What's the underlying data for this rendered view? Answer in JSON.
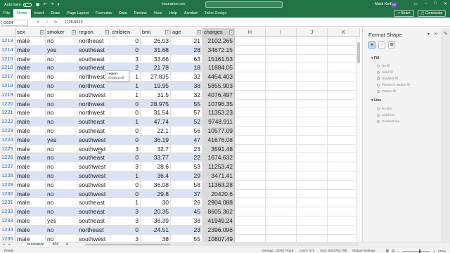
{
  "titlebar": {
    "autosave_label": "AutoSave",
    "autosave_state": "Off",
    "filename": "insurance.csv",
    "user_name": "Mark Keith",
    "user_initials": "MK"
  },
  "ribbon": {
    "tabs": [
      "File",
      "Home",
      "Insert",
      "Draw",
      "Page Layout",
      "Formulas",
      "Data",
      "Review",
      "View",
      "Help",
      "Acrobat",
      "Table Design"
    ],
    "active_tab": "Home",
    "share_label": "Share",
    "comments_label": "Comments"
  },
  "formula_bar": {
    "name_box": "G664",
    "formula": "1725.5523"
  },
  "columns": {
    "headers": [
      "sex",
      "smoker",
      "region",
      "children",
      "bmi",
      "age",
      "charges"
    ],
    "letters": [
      "H",
      "I",
      "J",
      "K"
    ]
  },
  "rows": [
    {
      "num": "1213",
      "sex": "male",
      "smoker": "no",
      "region": "northeast",
      "children": "0",
      "bmi": "26.03",
      "age": "21",
      "charges": "2102.265"
    },
    {
      "num": "1214",
      "sex": "male",
      "smoker": "yes",
      "region": "southeast",
      "children": "0",
      "bmi": "31.68",
      "age": "28",
      "charges": "34672.15"
    },
    {
      "num": "1215",
      "sex": "male",
      "smoker": "no",
      "region": "southeast",
      "children": "3",
      "bmi": "33.66",
      "age": "63",
      "charges": "15161.53"
    },
    {
      "num": "1216",
      "sex": "male",
      "smoker": "no",
      "region": "southeast",
      "children": "2",
      "bmi": "21.78",
      "age": "18",
      "charges": "11884.05"
    },
    {
      "num": "1217",
      "sex": "male",
      "smoker": "no",
      "region": "northwest",
      "children": "1",
      "bmi": "27.835",
      "age": "32",
      "charges": "4454.403"
    },
    {
      "num": "1218",
      "sex": "male",
      "smoker": "no",
      "region": "northwest",
      "children": "1",
      "bmi": "19.95",
      "age": "38",
      "charges": "5855.903"
    },
    {
      "num": "1219",
      "sex": "male",
      "smoker": "no",
      "region": "southwest",
      "children": "1",
      "bmi": "31.5",
      "age": "32",
      "charges": "4076.497"
    },
    {
      "num": "1220",
      "sex": "male",
      "smoker": "no",
      "region": "northwest",
      "children": "0",
      "bmi": "28.975",
      "age": "55",
      "charges": "10796.35"
    },
    {
      "num": "1221",
      "sex": "male",
      "smoker": "no",
      "region": "northwest",
      "children": "0",
      "bmi": "31.54",
      "age": "57",
      "charges": "11353.23"
    },
    {
      "num": "1222",
      "sex": "male",
      "smoker": "no",
      "region": "southeast",
      "children": "1",
      "bmi": "47.74",
      "age": "52",
      "charges": "9748.911"
    },
    {
      "num": "1223",
      "sex": "male",
      "smoker": "no",
      "region": "southeast",
      "children": "0",
      "bmi": "22.1",
      "age": "56",
      "charges": "10577.09"
    },
    {
      "num": "1224",
      "sex": "male",
      "smoker": "yes",
      "region": "southwest",
      "children": "0",
      "bmi": "36.19",
      "age": "47",
      "charges": "41676.08"
    },
    {
      "num": "1225",
      "sex": "male",
      "smoker": "no",
      "region": "southwest",
      "children": "3",
      "bmi": "32.7",
      "age": "23",
      "charges": "3591.48"
    },
    {
      "num": "1226",
      "sex": "male",
      "smoker": "no",
      "region": "southeast",
      "children": "0",
      "bmi": "33.77",
      "age": "22",
      "charges": "1674.632"
    },
    {
      "num": "1227",
      "sex": "male",
      "smoker": "no",
      "region": "southwest",
      "children": "3",
      "bmi": "28.6",
      "age": "53",
      "charges": "11253.42"
    },
    {
      "num": "1228",
      "sex": "male",
      "smoker": "no",
      "region": "southwest",
      "children": "1",
      "bmi": "36.4",
      "age": "29",
      "charges": "3471.41"
    },
    {
      "num": "1229",
      "sex": "male",
      "smoker": "no",
      "region": "southwest",
      "children": "0",
      "bmi": "36.08",
      "age": "58",
      "charges": "11363.28"
    },
    {
      "num": "1230",
      "sex": "male",
      "smoker": "no",
      "region": "southwest",
      "children": "0",
      "bmi": "29.8",
      "age": "37",
      "charges": "20420.6"
    },
    {
      "num": "1231",
      "sex": "male",
      "smoker": "no",
      "region": "southeast",
      "children": "1",
      "bmi": "30",
      "age": "26",
      "charges": "2904.088"
    },
    {
      "num": "1232",
      "sex": "male",
      "smoker": "no",
      "region": "southeast",
      "children": "3",
      "bmi": "20.35",
      "age": "45",
      "charges": "8605.362"
    },
    {
      "num": "1233",
      "sex": "male",
      "smoker": "yes",
      "region": "southeast",
      "children": "3",
      "bmi": "38.39",
      "age": "38",
      "charges": "41949.24"
    },
    {
      "num": "1234",
      "sex": "male",
      "smoker": "no",
      "region": "northeast",
      "children": "0",
      "bmi": "24.51",
      "age": "23",
      "charges": "2396.096"
    },
    {
      "num": "1235",
      "sex": "male",
      "smoker": "no",
      "region": "southwest",
      "children": "3",
      "bmi": "38",
      "age": "55",
      "charges": "10807.49"
    }
  ],
  "tooltip": {
    "title": "region:",
    "body": "Showing All"
  },
  "format_pane": {
    "title": "Format Shape",
    "fill_section": "Fill",
    "fill_options": [
      "No fill",
      "Solid fill",
      "Gradient fill",
      "Picture or texture fill",
      "Pattern fill"
    ],
    "line_section": "Line",
    "line_options": [
      "No line",
      "Solid line",
      "Gradient line"
    ]
  },
  "sheet_tabs": {
    "tabs": [
      "insurance",
      "###"
    ],
    "active": "insurance"
  },
  "status_bar": {
    "ready": "Ready",
    "average": "Average: 13050.75118",
    "count": "Count: 678",
    "sum": "Sum: 9434763.796",
    "display_settings": "Display Settings",
    "zoom": "175%"
  },
  "colors": {
    "excel_green": "#217346",
    "band_blue": "#dae3f3",
    "selected_col": "#d9d9d9"
  }
}
